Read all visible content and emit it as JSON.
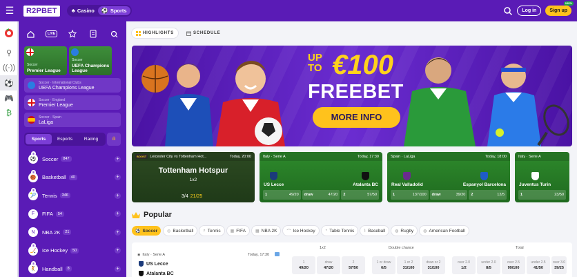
{
  "topbar": {
    "logo": "R2PBET",
    "modes": [
      {
        "label": "Casino"
      },
      {
        "label": "Sports"
      }
    ],
    "login": "Log in",
    "signup": "Sign up",
    "signup_badge": "100%"
  },
  "sidebar": {
    "live_label": "LIVE",
    "featured": [
      {
        "sport": "Soccer",
        "league": "Premier League"
      },
      {
        "sport": "Soccer",
        "league": "UEFA Champions League"
      }
    ],
    "leagues": [
      {
        "path": "Soccer · International Clubs",
        "name": "UEFA Champions League"
      },
      {
        "path": "Soccer · England",
        "name": "Premier League"
      },
      {
        "path": "Soccer · Spain",
        "name": "LaLiga"
      }
    ],
    "tabs": [
      "Sports",
      "Esports",
      "Racing"
    ],
    "sports": [
      {
        "name": "Soccer",
        "count": "847",
        "badge": "8",
        "icon": "⚽"
      },
      {
        "name": "Basketball",
        "count": "40",
        "badge": "8",
        "icon": "🏀"
      },
      {
        "name": "Tennis",
        "count": "346",
        "badge": "8",
        "icon": "🎾"
      },
      {
        "name": "FIFA",
        "count": "54",
        "badge": "",
        "icon": "F"
      },
      {
        "name": "NBA 2K",
        "count": "21",
        "badge": "",
        "icon": "N"
      },
      {
        "name": "Ice Hockey",
        "count": "50",
        "badge": "8",
        "icon": "🏒"
      },
      {
        "name": "Handball",
        "count": "8",
        "badge": "8",
        "icon": "🤾"
      }
    ]
  },
  "main": {
    "tabs": [
      {
        "label": "HIGHLIGHTS"
      },
      {
        "label": "SCHEDULE"
      }
    ],
    "banner": {
      "line1": "UP TO",
      "amount": "€100",
      "line2": "FREEBET",
      "button": "MORE INFO"
    },
    "cards": [
      {
        "boost": "BOOST",
        "header": "Leicester City vs Tottenham Hot...",
        "time": "Today, 20:00",
        "title": "Tottenham Hotspur",
        "market": "1x2",
        "old_odds": "3/4",
        "new_odds": "21/25"
      },
      {
        "header": "Italy · Serie A",
        "time": "Today, 17:30",
        "home": "US Lecce",
        "away": "Atalanta BC",
        "odds": [
          {
            "l": "1",
            "v": "49/20"
          },
          {
            "l": "draw",
            "v": "47/20"
          },
          {
            "l": "2",
            "v": "57/50"
          }
        ]
      },
      {
        "header": "Spain · LaLiga",
        "time": "Today, 18:00",
        "home": "Real Valladolid",
        "away": "Espanyol Barcelona",
        "odds": [
          {
            "l": "1",
            "v": "137/100"
          },
          {
            "l": "draw",
            "v": "39/20"
          },
          {
            "l": "2",
            "v": "12/5"
          }
        ]
      },
      {
        "header": "Italy · Serie A",
        "time": "",
        "home": "Juventus Turin",
        "away": "",
        "odds": [
          {
            "l": "1",
            "v": "23/50"
          }
        ]
      }
    ],
    "popular": {
      "title": "Popular",
      "chips": [
        "Soccer",
        "Basketball",
        "Tennis",
        "FIFA",
        "NBA 2K",
        "Ice Hockey",
        "Table Tennis",
        "Baseball",
        "Rugby",
        "American Football"
      ],
      "columns": {
        "c1": "1x2",
        "c2": "Double chance",
        "c3": "Total"
      },
      "match": {
        "league": "Italy · Serie A",
        "time": "Today, 17:30",
        "home": "US Lecce",
        "away": "Atalanta BC",
        "odds": [
          {
            "l": "1",
            "v": "49/20"
          },
          {
            "l": "draw",
            "v": "47/20"
          },
          {
            "l": "2",
            "v": "57/50"
          },
          {
            "l": "1 or draw",
            "v": "6/5"
          },
          {
            "l": "1 or 2",
            "v": "31/100"
          },
          {
            "l": "draw or 2",
            "v": "31/100"
          },
          {
            "l": "over 2.0",
            "v": "1/2"
          },
          {
            "l": "under 2.0",
            "v": "8/5"
          },
          {
            "l": "over 2.5",
            "v": "99/100"
          },
          {
            "l": "under 2.5",
            "v": "41/50"
          },
          {
            "l": "over 3.0",
            "v": "39/25"
          }
        ]
      }
    }
  },
  "colors": {
    "brand": "#5a1bb6",
    "accent": "#ffc21c",
    "pitch": "#2e8a2c"
  }
}
